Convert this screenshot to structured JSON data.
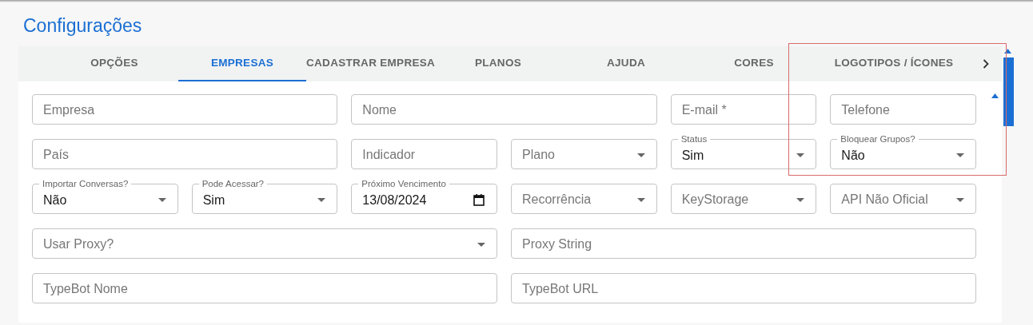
{
  "page_title": "Configurações",
  "tabs": [
    {
      "label": "OPÇÕES",
      "selected": false
    },
    {
      "label": "EMPRESAS",
      "selected": true
    },
    {
      "label": "CADASTRAR EMPRESA",
      "selected": false
    },
    {
      "label": "PLANOS",
      "selected": false
    },
    {
      "label": "AJUDA",
      "selected": false
    },
    {
      "label": "CORES",
      "selected": false
    },
    {
      "label": "LOGOTIPOS / ÍCONES",
      "selected": false
    }
  ],
  "form_rows": [
    [
      {
        "kind": "text",
        "placeholder": "Empresa"
      },
      {
        "kind": "text",
        "placeholder": "Nome"
      },
      {
        "kind": "text",
        "placeholder": "E-mail *"
      },
      {
        "kind": "text",
        "placeholder": "Telefone"
      }
    ],
    [
      {
        "kind": "text",
        "placeholder": "País"
      },
      {
        "kind": "text",
        "placeholder": "Indicador"
      },
      {
        "kind": "select",
        "placeholder": "Plano"
      },
      {
        "kind": "select",
        "label": "Status",
        "value": "Sim"
      },
      {
        "kind": "select",
        "label": "Bloquear Grupos?",
        "value": "Não"
      }
    ],
    [
      {
        "kind": "select",
        "label": "Importar Conversas?",
        "value": "Não"
      },
      {
        "kind": "select",
        "label": "Pode Acessar?",
        "value": "Sim"
      },
      {
        "kind": "date",
        "label": "Próximo Vencimento",
        "value": "13/08/2024"
      },
      {
        "kind": "select",
        "placeholder": "Recorrência"
      },
      {
        "kind": "select",
        "placeholder": "KeyStorage"
      },
      {
        "kind": "select",
        "placeholder": "API Não Oficial"
      }
    ],
    [
      {
        "kind": "select",
        "placeholder": "Usar Proxy?"
      },
      {
        "kind": "text",
        "placeholder": "Proxy String"
      }
    ],
    [
      {
        "kind": "text",
        "placeholder": "TypeBot Nome"
      },
      {
        "kind": "text",
        "placeholder": "TypeBot URL"
      }
    ]
  ]
}
